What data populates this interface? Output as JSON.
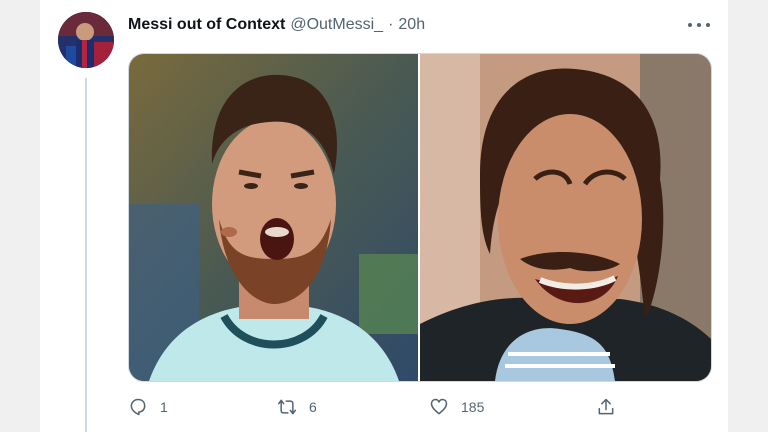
{
  "tweet": {
    "display_name": "Messi out of Context",
    "handle": "@OutMessi_",
    "separator": "·",
    "timestamp": "20h"
  },
  "actions": {
    "reply_count": "1",
    "retweet_count": "6",
    "like_count": "185"
  },
  "icons": {
    "more": "more-horizontal-icon",
    "reply": "reply-icon",
    "retweet": "retweet-icon",
    "like": "heart-icon",
    "share": "share-icon"
  },
  "colors": {
    "text_primary": "#0f1419",
    "text_secondary": "#536471",
    "border": "#cfd9de"
  }
}
